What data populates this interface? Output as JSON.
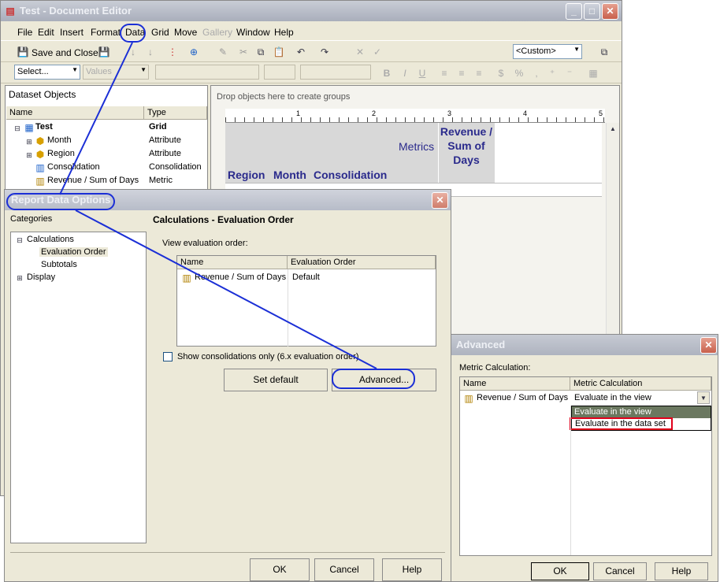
{
  "editor": {
    "title": "Test - Document Editor",
    "menus": [
      "File",
      "Edit",
      "Insert",
      "Format",
      "Data",
      "Grid",
      "Move",
      "Gallery",
      "Window",
      "Help"
    ],
    "toolbar": {
      "save_close": "Save and Close",
      "custom_combo": "<Custom>"
    },
    "format_bar": {
      "select_combo": "Select...",
      "values_combo": "Values"
    },
    "dataset_panel": {
      "title": "Dataset Objects",
      "col_name": "Name",
      "col_type": "Type",
      "rows": [
        {
          "name": "Test",
          "type": "Grid"
        },
        {
          "name": "Month",
          "type": "Attribute"
        },
        {
          "name": "Region",
          "type": "Attribute"
        },
        {
          "name": "Consolidation",
          "type": "Consolidation"
        },
        {
          "name": "Revenue / Sum of Days",
          "type": "Metric"
        }
      ]
    },
    "canvas": {
      "drop_text": "Drop objects here to create groups",
      "ruler": [
        "1",
        "2",
        "3",
        "4",
        "5"
      ],
      "metrics_label": "Metrics",
      "metric_header": "Revenue / Sum of Days",
      "row_headers": [
        "Region",
        "Month",
        "Consolidation"
      ]
    }
  },
  "rdo": {
    "title": "Report Data Options",
    "categories_label": "Categories",
    "section_title": "Calculations - Evaluation Order",
    "tree": [
      "Calculations",
      "Evaluation Order",
      "Subtotals",
      "Display"
    ],
    "view_label": "View evaluation order:",
    "col_name": "Name",
    "col_order": "Evaluation Order",
    "row_name": "Revenue / Sum of Days",
    "row_order": "Default",
    "checkbox_label": "Show consolidations only (6.x evaluation order)",
    "set_default": "Set default",
    "advanced": "Advanced...",
    "ok": "OK",
    "cancel": "Cancel",
    "help": "Help"
  },
  "adv": {
    "title": "Advanced",
    "metric_calc_label": "Metric Calculation:",
    "col_name": "Name",
    "col_calc": "Metric Calculation",
    "row_name": "Revenue / Sum of Days",
    "row_value": "Evaluate in the view",
    "options": [
      "Evaluate in the view",
      "Evaluate in the data set"
    ],
    "ok": "OK",
    "cancel": "Cancel",
    "help": "Help"
  }
}
